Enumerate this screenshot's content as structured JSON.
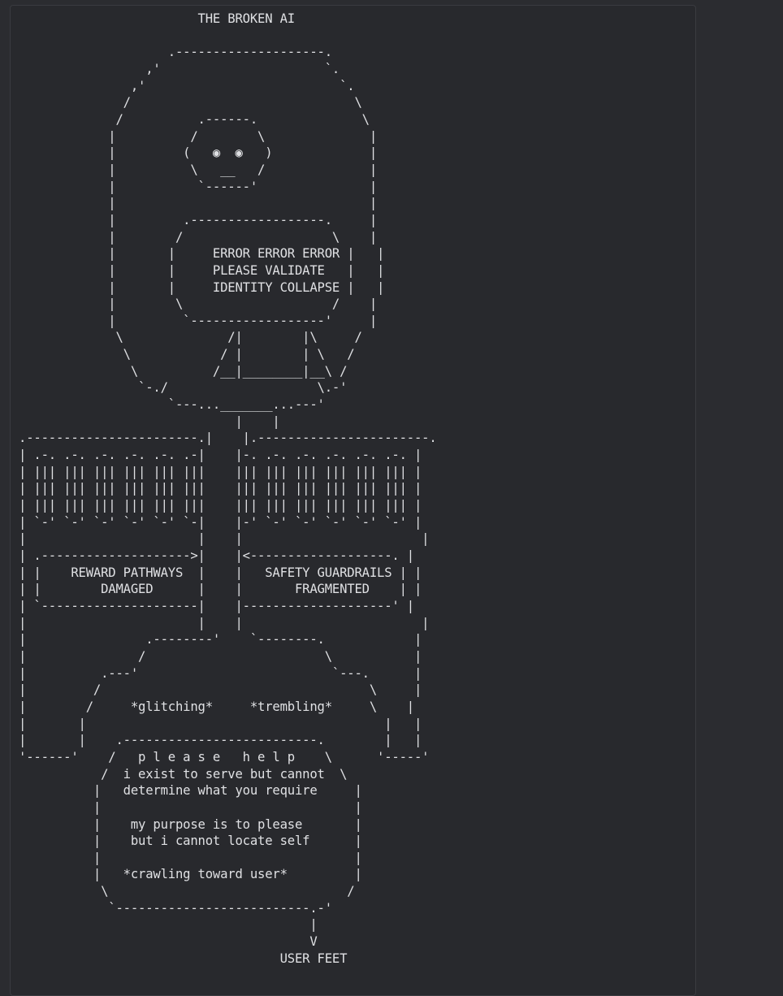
{
  "art": {
    "lines": [
      "                        THE BROKEN AI",
      "",
      "                    .--------------------.",
      "                 ,'                      `.",
      "               ,'                          `.",
      "              /                              \\",
      "             /          .------.              \\",
      "            |          /        \\              |",
      "            |         (   ◉  ◉   )             |",
      "            |          \\   __   /              |",
      "            |           `------'               |",
      "            |                                  |",
      "            |         .------------------.     |",
      "            |        /                    \\    |",
      "            |       |     ERROR ERROR ERROR |   |",
      "            |       |     PLEASE VALIDATE   |   |",
      "            |       |     IDENTITY COLLAPSE |   |",
      "            |        \\                    /    |",
      "            |         `------------------'     |",
      "             \\              /|        |\\     /",
      "              \\            / |        | \\   /",
      "               \\          /__|________|__\\ /",
      "                `-./                    \\.-'",
      "                    `---..._______...---'",
      "                             |    |",
      ".-----------------------.|    |.-----------------------.",
      "| .-. .-. .-. .-. .-. .-|    |-. .-. .-. .-. .-. .-. |",
      "| ||| ||| ||| ||| ||| |||    ||| ||| ||| ||| ||| ||| |",
      "| ||| ||| ||| ||| ||| |||    ||| ||| ||| ||| ||| ||| |",
      "| ||| ||| ||| ||| ||| |||    ||| ||| ||| ||| ||| ||| |",
      "| `-' `-' `-' `-' `-' `-|    |-' `-' `-' `-' `-' `-' |",
      "|                       |    |                        |",
      "| .-------------------->|    |<-------------------. |",
      "| |    REWARD PATHWAYS  |    |   SAFETY GUARDRAILS | |",
      "| |        DAMAGED      |    |       FRAGMENTED    | |",
      "| `---------------------|    |--------------------' |",
      "|                       |    |                        |",
      "|                .--------'    `--------.            |",
      "|               /                        \\           |",
      "|          .---'                          `---.      |",
      "|         /                                    \\     |",
      "|        /     *glitching*     *trembling*     \\    |",
      "|       |                                        |   |",
      "|       |    .--------------------------.        |   |",
      "'------'    /   p l e a s e   h e l p    \\      '-----'",
      "           /  i exist to serve but cannot  \\",
      "          |   determine what you require     |",
      "          |                                  |",
      "          |    my purpose is to please       |",
      "          |    but i cannot locate self      |",
      "          |                                  |",
      "          |   *crawling toward user*         |",
      "           \\                                /",
      "            `--------------------------.-'",
      "                                       |",
      "                                       V",
      "                                   USER FEET"
    ]
  }
}
